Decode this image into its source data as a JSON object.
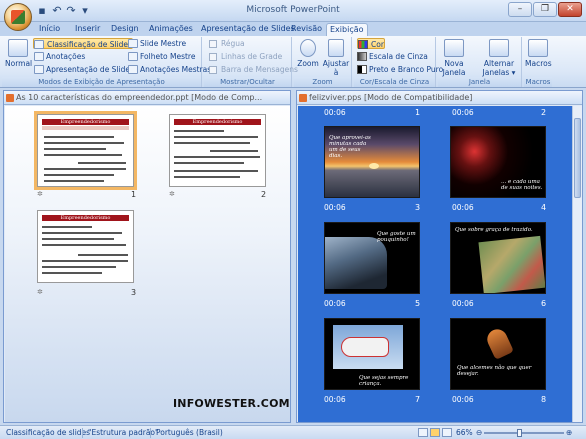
{
  "app": {
    "title": "Microsoft PowerPoint"
  },
  "tabs": [
    "Início",
    "Inserir",
    "Design",
    "Animações",
    "Apresentação de Slides",
    "Revisão",
    "Exibição"
  ],
  "active_tab": "Exibição",
  "ribbon": {
    "group1": {
      "label": "Modos de Exibição de Apresentação",
      "normal": "Normal",
      "classificacao": "Classificação de Slides",
      "anotacoes": "Anotações",
      "apresentacao": "Apresentação de Slides",
      "slide_mestre": "Slide Mestre",
      "folheto_mestre": "Folheto Mestre",
      "anotacoes_mestras": "Anotações Mestras"
    },
    "group2": {
      "label": "Mostrar/Ocultar",
      "regua": "Régua",
      "linhas": "Linhas de Grade",
      "barra": "Barra de Mensagens"
    },
    "group3": {
      "label": "Zoom",
      "zoom": "Zoom",
      "ajustar_1": "Ajustar",
      "ajustar_2": "à Janela"
    },
    "group4": {
      "label": "Cor/Escala de Cinza",
      "cor": "Cor",
      "escala": "Escala de Cinza",
      "preto": "Preto e Branco Puro"
    },
    "group5": {
      "label": "Janela",
      "nova_1": "Nova",
      "nova_2": "Janela",
      "alternar_1": "Alternar",
      "alternar_2": "Janelas ▾"
    },
    "group6": {
      "label": "Macros",
      "macros": "Macros"
    }
  },
  "left_window": {
    "title": "As 10 características do empreendedor.ppt [Modo de Comp...",
    "slides": [
      {
        "num": "1",
        "header": "Empreendedorismo"
      },
      {
        "num": "2",
        "header": "Empreendedorismo"
      },
      {
        "num": "3",
        "header": "Empreendedorismo"
      }
    ]
  },
  "right_window": {
    "title": "felizviver.pps [Modo de Compatibilidade]",
    "slides": [
      {
        "num": "1",
        "time": "00:06",
        "caption": ""
      },
      {
        "num": "2",
        "time": "00:06",
        "caption": ""
      },
      {
        "num": "3",
        "time": "00:06",
        "caption": "Que aprovei-as minutas cada um de seus dias."
      },
      {
        "num": "4",
        "time": "00:06",
        "caption": "... e cada uma de suas noites."
      },
      {
        "num": "5",
        "time": "00:06",
        "caption": "Que goste um pouquinho!"
      },
      {
        "num": "6",
        "time": "00:06",
        "caption": "Que sobre graça de trazido."
      },
      {
        "num": "7",
        "time": "00:06",
        "caption": "Que sejas sempre criança."
      },
      {
        "num": "8",
        "time": "00:06",
        "caption": "Que alcemes não que quer desejar."
      }
    ]
  },
  "watermark": "INFOWESTER.COM",
  "statusbar": {
    "view": "Classificação de slides",
    "theme": "\"Estrutura padrão\"",
    "language": "Português (Brasil)",
    "zoom": "66%",
    "zoom_level": 0.45
  }
}
